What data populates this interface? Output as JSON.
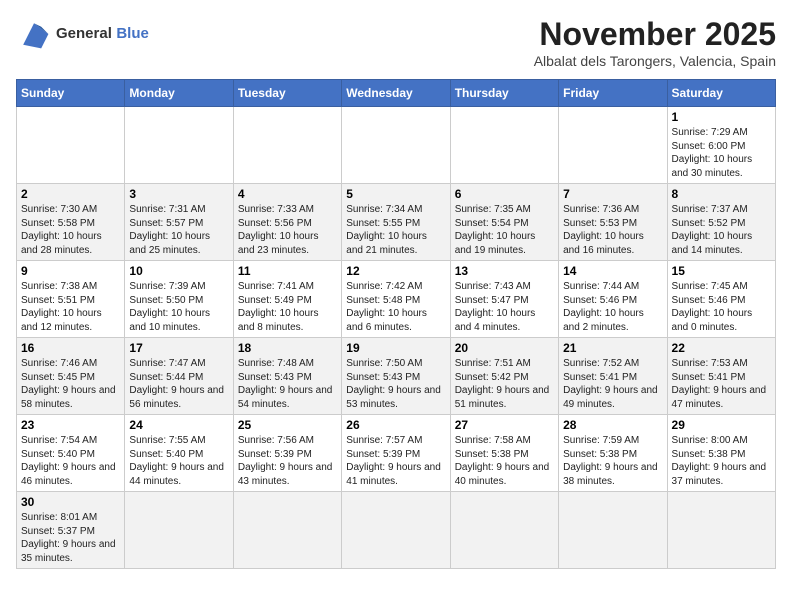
{
  "header": {
    "logo_line1": "General",
    "logo_line2": "Blue",
    "title": "November 2025",
    "subtitle": "Albalat dels Tarongers, Valencia, Spain"
  },
  "days_of_week": [
    "Sunday",
    "Monday",
    "Tuesday",
    "Wednesday",
    "Thursday",
    "Friday",
    "Saturday"
  ],
  "weeks": [
    [
      {
        "day": "",
        "info": ""
      },
      {
        "day": "",
        "info": ""
      },
      {
        "day": "",
        "info": ""
      },
      {
        "day": "",
        "info": ""
      },
      {
        "day": "",
        "info": ""
      },
      {
        "day": "",
        "info": ""
      },
      {
        "day": "1",
        "info": "Sunrise: 7:29 AM\nSunset: 6:00 PM\nDaylight: 10 hours and 30 minutes."
      }
    ],
    [
      {
        "day": "2",
        "info": "Sunrise: 7:30 AM\nSunset: 5:58 PM\nDaylight: 10 hours and 28 minutes."
      },
      {
        "day": "3",
        "info": "Sunrise: 7:31 AM\nSunset: 5:57 PM\nDaylight: 10 hours and 25 minutes."
      },
      {
        "day": "4",
        "info": "Sunrise: 7:33 AM\nSunset: 5:56 PM\nDaylight: 10 hours and 23 minutes."
      },
      {
        "day": "5",
        "info": "Sunrise: 7:34 AM\nSunset: 5:55 PM\nDaylight: 10 hours and 21 minutes."
      },
      {
        "day": "6",
        "info": "Sunrise: 7:35 AM\nSunset: 5:54 PM\nDaylight: 10 hours and 19 minutes."
      },
      {
        "day": "7",
        "info": "Sunrise: 7:36 AM\nSunset: 5:53 PM\nDaylight: 10 hours and 16 minutes."
      },
      {
        "day": "8",
        "info": "Sunrise: 7:37 AM\nSunset: 5:52 PM\nDaylight: 10 hours and 14 minutes."
      }
    ],
    [
      {
        "day": "9",
        "info": "Sunrise: 7:38 AM\nSunset: 5:51 PM\nDaylight: 10 hours and 12 minutes."
      },
      {
        "day": "10",
        "info": "Sunrise: 7:39 AM\nSunset: 5:50 PM\nDaylight: 10 hours and 10 minutes."
      },
      {
        "day": "11",
        "info": "Sunrise: 7:41 AM\nSunset: 5:49 PM\nDaylight: 10 hours and 8 minutes."
      },
      {
        "day": "12",
        "info": "Sunrise: 7:42 AM\nSunset: 5:48 PM\nDaylight: 10 hours and 6 minutes."
      },
      {
        "day": "13",
        "info": "Sunrise: 7:43 AM\nSunset: 5:47 PM\nDaylight: 10 hours and 4 minutes."
      },
      {
        "day": "14",
        "info": "Sunrise: 7:44 AM\nSunset: 5:46 PM\nDaylight: 10 hours and 2 minutes."
      },
      {
        "day": "15",
        "info": "Sunrise: 7:45 AM\nSunset: 5:46 PM\nDaylight: 10 hours and 0 minutes."
      }
    ],
    [
      {
        "day": "16",
        "info": "Sunrise: 7:46 AM\nSunset: 5:45 PM\nDaylight: 9 hours and 58 minutes."
      },
      {
        "day": "17",
        "info": "Sunrise: 7:47 AM\nSunset: 5:44 PM\nDaylight: 9 hours and 56 minutes."
      },
      {
        "day": "18",
        "info": "Sunrise: 7:48 AM\nSunset: 5:43 PM\nDaylight: 9 hours and 54 minutes."
      },
      {
        "day": "19",
        "info": "Sunrise: 7:50 AM\nSunset: 5:43 PM\nDaylight: 9 hours and 53 minutes."
      },
      {
        "day": "20",
        "info": "Sunrise: 7:51 AM\nSunset: 5:42 PM\nDaylight: 9 hours and 51 minutes."
      },
      {
        "day": "21",
        "info": "Sunrise: 7:52 AM\nSunset: 5:41 PM\nDaylight: 9 hours and 49 minutes."
      },
      {
        "day": "22",
        "info": "Sunrise: 7:53 AM\nSunset: 5:41 PM\nDaylight: 9 hours and 47 minutes."
      }
    ],
    [
      {
        "day": "23",
        "info": "Sunrise: 7:54 AM\nSunset: 5:40 PM\nDaylight: 9 hours and 46 minutes."
      },
      {
        "day": "24",
        "info": "Sunrise: 7:55 AM\nSunset: 5:40 PM\nDaylight: 9 hours and 44 minutes."
      },
      {
        "day": "25",
        "info": "Sunrise: 7:56 AM\nSunset: 5:39 PM\nDaylight: 9 hours and 43 minutes."
      },
      {
        "day": "26",
        "info": "Sunrise: 7:57 AM\nSunset: 5:39 PM\nDaylight: 9 hours and 41 minutes."
      },
      {
        "day": "27",
        "info": "Sunrise: 7:58 AM\nSunset: 5:38 PM\nDaylight: 9 hours and 40 minutes."
      },
      {
        "day": "28",
        "info": "Sunrise: 7:59 AM\nSunset: 5:38 PM\nDaylight: 9 hours and 38 minutes."
      },
      {
        "day": "29",
        "info": "Sunrise: 8:00 AM\nSunset: 5:38 PM\nDaylight: 9 hours and 37 minutes."
      }
    ],
    [
      {
        "day": "30",
        "info": "Sunrise: 8:01 AM\nSunset: 5:37 PM\nDaylight: 9 hours and 35 minutes."
      },
      {
        "day": "",
        "info": ""
      },
      {
        "day": "",
        "info": ""
      },
      {
        "day": "",
        "info": ""
      },
      {
        "day": "",
        "info": ""
      },
      {
        "day": "",
        "info": ""
      },
      {
        "day": "",
        "info": ""
      }
    ]
  ]
}
